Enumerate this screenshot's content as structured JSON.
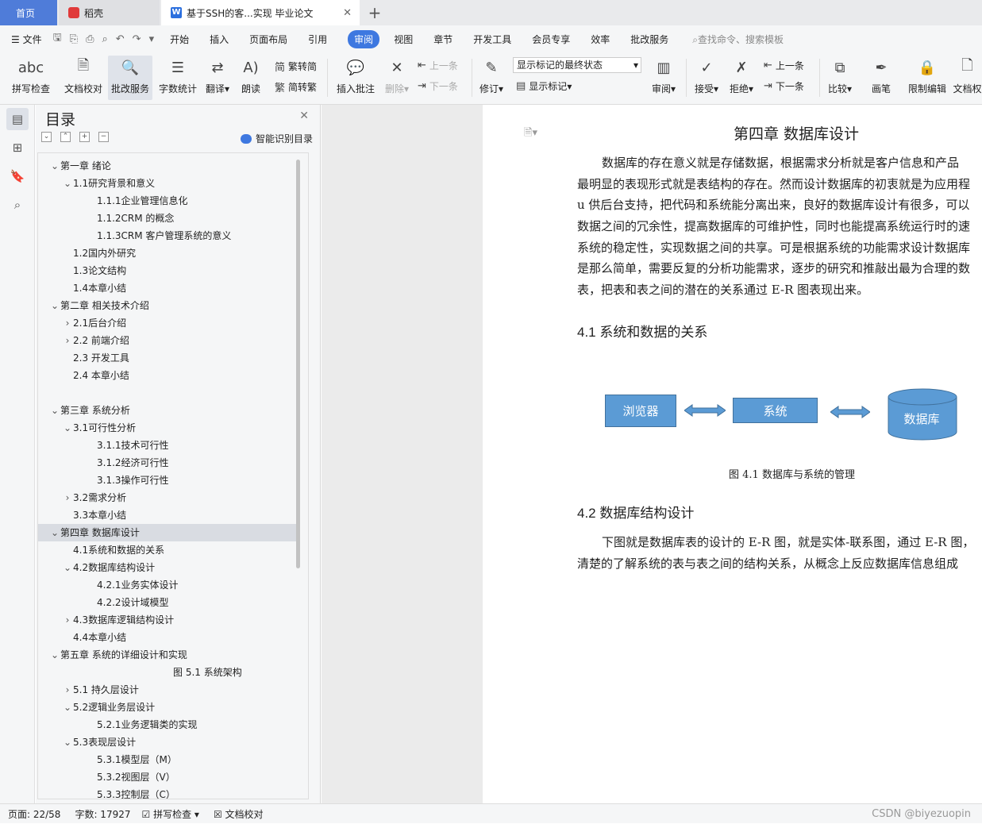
{
  "tabs": {
    "home": "首页",
    "daoke": "稻壳",
    "doc": "基于SSH的客...实现 毕业论文"
  },
  "menu": {
    "file": "文件",
    "items": [
      "开始",
      "插入",
      "页面布局",
      "引用",
      "审阅",
      "视图",
      "章节",
      "开发工具",
      "会员专享",
      "效率",
      "批改服务"
    ],
    "active": "审阅",
    "search": "查找命令、搜索模板"
  },
  "ribbon": {
    "spell_check": "拼写检查",
    "doc_check": "文档校对",
    "review_service": "批改服务",
    "word_count": "字数统计",
    "translate": "翻译",
    "read_aloud": "朗读",
    "trad_to_simp": "繁转简",
    "simp_to_trad": "简转繁",
    "insert_comment": "插入批注",
    "delete": "删除",
    "prev": "上一条",
    "next": "下一条",
    "revise": "修订",
    "markup_state": "显示标记的最终状态",
    "show_markup": "显示标记",
    "review": "审阅",
    "accept": "接受",
    "reject": "拒绝",
    "prev2": "上一条",
    "next2": "下一条",
    "compare": "比较",
    "pen": "画笔",
    "restrict": "限制编辑",
    "doc_rights": "文档权"
  },
  "toc": {
    "title": "目录",
    "smart": "智能识别目录",
    "items": [
      {
        "text": "第一章  绪论",
        "level": 0,
        "caret": "v"
      },
      {
        "text": "1.1研究背景和意义",
        "level": 1,
        "caret": "v"
      },
      {
        "text": "1.1.1企业管理信息化",
        "level": 2,
        "caret": ""
      },
      {
        "text": "1.1.2CRM 的概念",
        "level": 2,
        "caret": ""
      },
      {
        "text": "1.1.3CRM 客户管理系统的意义",
        "level": 2,
        "caret": ""
      },
      {
        "text": "1.2国内外研究",
        "level": 1,
        "caret": ""
      },
      {
        "text": "1.3论文结构",
        "level": 1,
        "caret": ""
      },
      {
        "text": "1.4本章小结",
        "level": 1,
        "caret": ""
      },
      {
        "text": "第二章  相关技术介绍",
        "level": 0,
        "caret": "v"
      },
      {
        "text": "2.1后台介绍",
        "level": 1,
        "caret": ">"
      },
      {
        "text": "2.2 前端介绍",
        "level": 1,
        "caret": ">"
      },
      {
        "text": "2.3 开发工具",
        "level": 1,
        "caret": ""
      },
      {
        "text": "2.4 本章小结",
        "level": 1,
        "caret": ""
      },
      {
        "text": "",
        "level": 1,
        "caret": ""
      },
      {
        "text": "第三章  系统分析",
        "level": 0,
        "caret": "v"
      },
      {
        "text": "3.1可行性分析",
        "level": 1,
        "caret": "v"
      },
      {
        "text": "3.1.1技术可行性",
        "level": 2,
        "caret": ""
      },
      {
        "text": "3.1.2经济可行性",
        "level": 2,
        "caret": ""
      },
      {
        "text": "3.1.3操作可行性",
        "level": 2,
        "caret": ""
      },
      {
        "text": "3.2需求分析",
        "level": 1,
        "caret": ">"
      },
      {
        "text": "3.3本章小结",
        "level": 1,
        "caret": ""
      },
      {
        "text": "第四章  数据库设计",
        "level": 0,
        "caret": "v",
        "active": true
      },
      {
        "text": "4.1系统和数据的关系",
        "level": 1,
        "caret": ""
      },
      {
        "text": "4.2数据库结构设计",
        "level": 1,
        "caret": "v"
      },
      {
        "text": "4.2.1业务实体设计",
        "level": 2,
        "caret": ""
      },
      {
        "text": "4.2.2设计域模型",
        "level": 2,
        "caret": ""
      },
      {
        "text": "4.3数据库逻辑结构设计",
        "level": 1,
        "caret": ">"
      },
      {
        "text": "4.4本章小结",
        "level": 1,
        "caret": ""
      },
      {
        "text": "第五章  系统的详细设计和实现",
        "level": 0,
        "caret": "v"
      },
      {
        "text": "图 5.1 系统架构",
        "level": 4,
        "caret": ""
      },
      {
        "text": "5.1 持久层设计",
        "level": 1,
        "caret": ">"
      },
      {
        "text": "5.2逻辑业务层设计",
        "level": 1,
        "caret": "v"
      },
      {
        "text": "5.2.1业务逻辑类的实现",
        "level": 2,
        "caret": ""
      },
      {
        "text": "5.3表现层设计",
        "level": 1,
        "caret": "v"
      },
      {
        "text": "5.3.1模型层（M）",
        "level": 2,
        "caret": ""
      },
      {
        "text": "5.3.2视图层（V）",
        "level": 2,
        "caret": ""
      },
      {
        "text": "5.3.3控制层（C）",
        "level": 2,
        "caret": ""
      }
    ]
  },
  "doc": {
    "chapter_title": "第四章    数据库设计",
    "para1": [
      "数据库的存在意义就是存储数据，根据需求分析就是客户信息和产品",
      "最明显的表现形式就是表结构的存在。然而设计数据库的初衷就是为应用程",
      "u 供后台支持，把代码和系统能分离出来，良好的数据库设计有很多，可以",
      "数据之间的冗余性，提高数据库的可维护性，同时也能提高系统运行时的速",
      "系统的稳定性，实现数据之间的共享。可是根据系统的功能需求设计数据库",
      "是那么简单，需要反复的分析功能需求，逐步的研究和推敲出最为合理的数",
      "表，把表和表之间的潜在的关系通过 E-R 图表现出来。"
    ],
    "h41": "4.1  系统和数据的关系",
    "diagram": {
      "browser": "浏览器",
      "system": "系统",
      "database": "数据库"
    },
    "caption": "图 4.1  数据库与系统的管理",
    "h42": "4.2  数据库结构设计",
    "para2": [
      "下图就是数据库表的设计的 E-R 图，就是实体-联系图，通过 E-R 图，",
      "清楚的了解系统的表与表之间的结构关系，从概念上反应数据库信息组成"
    ]
  },
  "status": {
    "page": "页面: 22/58",
    "words": "字数: 17927",
    "spell": "拼写检查",
    "proof": "文档校对",
    "watermark": "CSDN @biyezuopin"
  }
}
